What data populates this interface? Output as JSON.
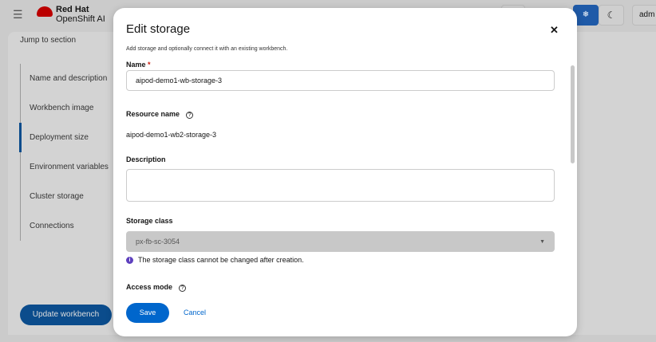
{
  "header": {
    "brand_line1": "Red Hat",
    "brand_line2": "OpenShift AI",
    "user": "adm"
  },
  "sidebar": {
    "title": "Jump to section",
    "items": [
      {
        "label": "Name and description"
      },
      {
        "label": "Workbench image"
      },
      {
        "label": "Deployment size",
        "active": true
      },
      {
        "label": "Environment variables"
      },
      {
        "label": "Cluster storage"
      },
      {
        "label": "Connections"
      }
    ]
  },
  "page": {
    "update_button": "Update workbench"
  },
  "modal": {
    "title": "Edit storage",
    "description": "Add storage and optionally connect it with an existing workbench.",
    "name_label": "Name",
    "name_value": "aipod-demo1-wb-storage-3",
    "resource_name_label": "Resource name",
    "resource_name_value": "aipod-demo1-wb2-storage-3",
    "description_label": "Description",
    "description_value": "",
    "storage_class_label": "Storage class",
    "storage_class_value": "px-fb-sc-3054",
    "storage_class_helper": "The storage class cannot be changed after creation.",
    "access_mode_label": "Access mode",
    "save": "Save",
    "cancel": "Cancel"
  },
  "colors": {
    "primary": "#0066cc",
    "info": "#5e40be"
  }
}
